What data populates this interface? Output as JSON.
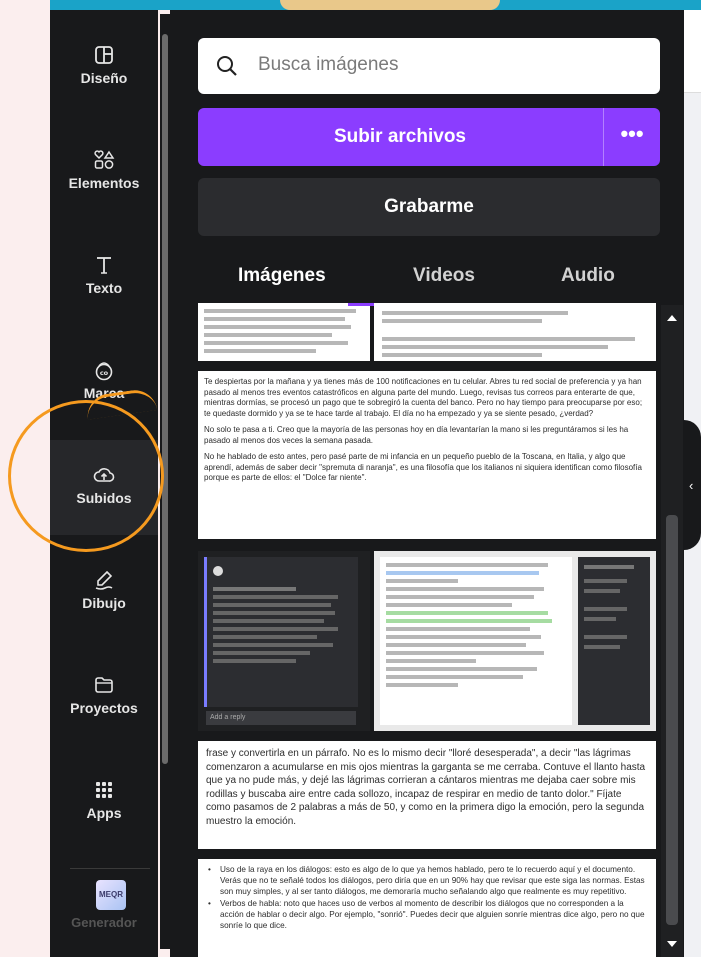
{
  "sidebar": {
    "items": [
      {
        "label": "Diseño",
        "icon": "layout-icon"
      },
      {
        "label": "Elementos",
        "icon": "shapes-icon"
      },
      {
        "label": "Texto",
        "icon": "text-icon"
      },
      {
        "label": "Marca",
        "icon": "brand-icon"
      },
      {
        "label": "Subidos",
        "icon": "cloud-upload-icon"
      },
      {
        "label": "Dibujo",
        "icon": "draw-icon"
      },
      {
        "label": "Proyectos",
        "icon": "folder-icon"
      },
      {
        "label": "Apps",
        "icon": "apps-grid-icon"
      }
    ],
    "bottom_app_badge": "MEQR",
    "bottom_app_label": "Generador"
  },
  "panel": {
    "search_placeholder": "Busca imágenes",
    "upload_button": "Subir archivos",
    "upload_more": "•••",
    "record_button": "Grabarme",
    "tabs": [
      "Imágenes",
      "Videos",
      "Audio"
    ]
  },
  "thumbnails": {
    "doc1_text": "Te despiertas por la mañana y ya tienes más de 100 notificaciones en tu celular. Abres tu red social de preferencia y ya han pasado al menos tres eventos catastróficos en alguna parte del mundo. Luego, revisas tus correos para enterarte de que, mientras dormías, se procesó un pago que te sobregiró la cuenta del banco. Pero no hay tiempo para preocuparse por eso; te quedaste dormido y ya se te hace tarde al trabajo. El día no ha empezado y ya se siente pesado, ¿verdad?",
    "doc1_text2": "No solo te pasa a ti. Creo que la mayoría de las personas hoy en día levantarían la mano si les preguntáramos si les ha pasado al menos dos veces la semana pasada.",
    "doc1_text3": "No he hablado de esto antes, pero pasé parte de mi infancia en un pequeño pueblo de la Toscana, en Italia, y algo que aprendí, además de saber decir \"spremuta di naranja\", es una filosofía que los italianos ni siquiera identifican como filosofía porque es parte de ellos: el \"Dolce far niente\".",
    "doc2_text": "frase y convertirla en un párrafo. No es lo mismo decir \"lloré desesperada\", a decir \"las lágrimas comenzaron a acumularse en mis ojos mientras la garganta se me cerraba. Contuve el llanto hasta que ya no pude más, y dejé las lágrimas corrieran a cántaros mientras me dejaba caer sobre mis rodillas y buscaba aire entre cada sollozo, incapaz de respirar en medio de tanto dolor.\" Fíjate como pasamos de 2 palabras a más de 50, y como en la primera digo la emoción, pero la segunda muestro la emoción.",
    "doc3_bullet1": "Uso de la raya en los diálogos: esto es algo de lo que ya hemos hablado, pero te lo recuerdo aquí y el documento. Verás que no te señalé todos los diálogos, pero diría que en un 90% hay que revisar que este siga las normas. Estas son muy simples, y al ser tanto diálogos, me demoraría mucho señalando algo que realmente es muy repetitivo.",
    "doc3_bullet2": "Verbos de habla: noto que haces uso de verbos al momento de describir los diálogos que no corresponden a la acción de hablar o decir algo. Por ejemplo, \"sonrió\". Puedes decir que alguien sonríe mientras dice algo, pero no que sonríe lo que dice.",
    "comment_reply_placeholder": "Add a reply"
  },
  "colors": {
    "accent": "#8b3dff",
    "sidebar_bg": "#18191b",
    "highlight_ring": "#f59a1f",
    "page_bg": "#fbeeee"
  }
}
